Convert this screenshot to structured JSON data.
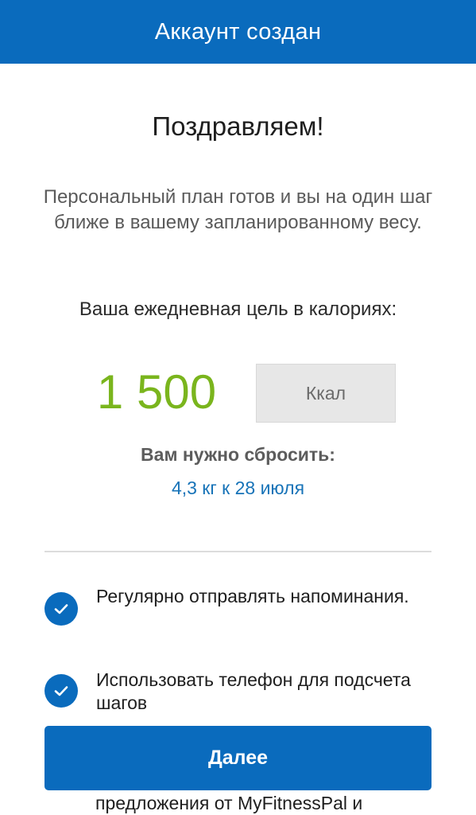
{
  "header": {
    "title": "Аккаунт создан"
  },
  "main": {
    "title": "Поздравляем!",
    "subtitle": "Персональный план готов и вы на один шаг ближе в вашему запланированному весу.",
    "goal_label": "Ваша ежедневная цель в калориях:",
    "calories_value": "1 500",
    "calories_unit": "Ккал",
    "lose_label": "Вам нужно сбросить:",
    "lose_value": "4,3 кг к 28 июля"
  },
  "options": [
    {
      "label": "Регулярно отправлять напоминания.",
      "checked": true
    },
    {
      "label": "Использовать телефон для подсчета шагов",
      "checked": true
    }
  ],
  "partial_text": "предложения от MyFitnessPal и",
  "button": {
    "label": "Далее"
  },
  "colors": {
    "brand_blue": "#0a6bbd",
    "calorie_green": "#7ab51d",
    "link_blue": "#1773b8"
  },
  "icons": {
    "check": "checkmark-circle-icon"
  }
}
